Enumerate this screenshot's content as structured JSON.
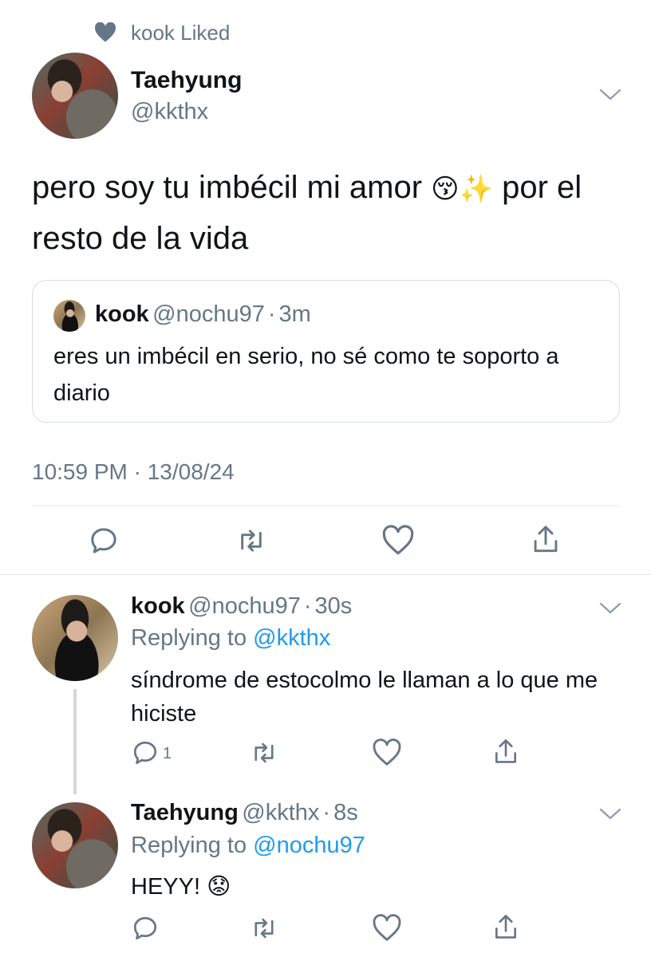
{
  "social_context": {
    "text": "kook Liked",
    "icon": "heart-icon"
  },
  "main_tweet": {
    "name": "Taehyung",
    "handle": "@kkthx",
    "text_part1": "pero soy tu imbécil mi amor",
    "text_emoji1": "😚",
    "text_emoji2": "✨",
    "text_part2": "por el resto de la vida",
    "quote": {
      "name": "kook",
      "handle": "@nochu97",
      "time": "3m",
      "text": "eres un imbécil en serio, no sé como te soporto a diario"
    },
    "timestamp": "10:59 PM · 13/08/24"
  },
  "replies": [
    {
      "name": "kook",
      "handle": "@nochu97",
      "time": "30s",
      "replying_prefix": "Replying to",
      "replying_to": "@kkthx",
      "text": "síndrome de estocolmo le llaman a lo que me hiciste",
      "reply_count": "1"
    },
    {
      "name": "Taehyung",
      "handle": "@kkthx",
      "time": "8s",
      "replying_prefix": "Replying to",
      "replying_to": "@nochu97",
      "text": "HEYY! 😟",
      "reply_count": ""
    }
  ],
  "separator": "·",
  "colors": {
    "link": "#1d9bf0",
    "secondary": "#657786",
    "border": "#e1e8ed"
  }
}
